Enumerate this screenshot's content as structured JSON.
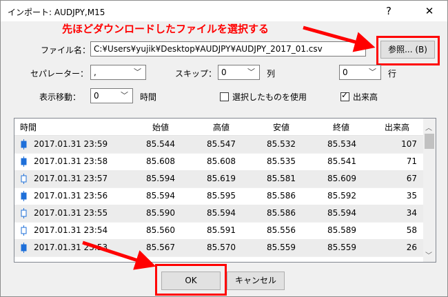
{
  "window": {
    "title": "インポート: AUDJPY,M15",
    "help": "?",
    "close": "✕"
  },
  "annotation": "先ほどダウンロードしたファイルを選択する",
  "file": {
    "label": "ファイル名：",
    "path": "C:¥Users¥yujik¥Desktop¥AUDJPY¥AUDJPY_2017_01.csv",
    "browse": "参照... (B)"
  },
  "options": {
    "separator_label": "セパレーター：",
    "separator_value": ",",
    "skip_label": "スキップ：",
    "skip_col_value": "0",
    "col_unit": "列",
    "skip_row_value": "0",
    "row_unit": "行",
    "shift_label": "表示移動：",
    "shift_value": "0",
    "shift_unit": "時間",
    "use_selected_label": "選択したものを使用",
    "volume_label": "出来高"
  },
  "table": {
    "headers": [
      "時間",
      "始値",
      "高値",
      "安値",
      "終値",
      "出来高"
    ],
    "rows": [
      [
        "2017.01.31 23:59",
        "85.544",
        "85.547",
        "85.532",
        "85.534",
        "107"
      ],
      [
        "2017.01.31 23:58",
        "85.608",
        "85.608",
        "85.535",
        "85.541",
        "71"
      ],
      [
        "2017.01.31 23:57",
        "85.594",
        "85.619",
        "85.581",
        "85.609",
        "67"
      ],
      [
        "2017.01.31 23:56",
        "85.594",
        "85.595",
        "85.586",
        "85.592",
        "35"
      ],
      [
        "2017.01.31 23:55",
        "85.590",
        "85.594",
        "85.586",
        "85.594",
        "34"
      ],
      [
        "2017.01.31 23:54",
        "85.560",
        "85.591",
        "85.556",
        "85.589",
        "58"
      ],
      [
        "2017.01.31 23:53",
        "85.567",
        "85.570",
        "85.559",
        "85.559",
        "26"
      ]
    ]
  },
  "buttons": {
    "ok": "OK",
    "cancel": "キャンセル"
  },
  "colors": {
    "annotation": "#ff0000",
    "candle": "#1e6fd9"
  }
}
